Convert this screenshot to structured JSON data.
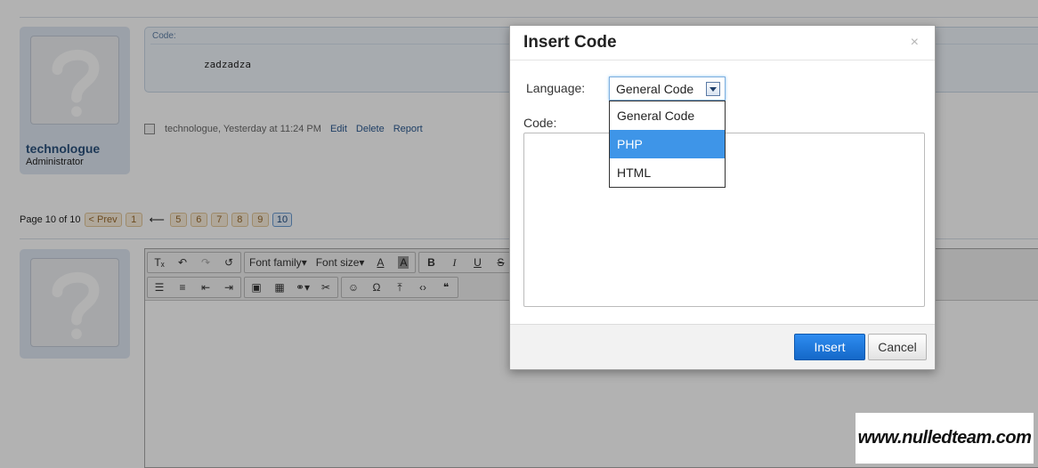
{
  "message": {
    "user_name": "technologue",
    "user_title": "Administrator",
    "code_label": "Code:",
    "code_text": "zadzadza",
    "meta_text": "technologue, Yesterday at 11:24 PM",
    "actions": [
      "Edit",
      "Delete",
      "Report"
    ]
  },
  "pagination": {
    "summary": "Page 10 of 10",
    "prev_label": "< Prev",
    "pages": [
      "1",
      "5",
      "6",
      "7",
      "8",
      "9",
      "10"
    ],
    "current": "10",
    "gap_arrow": "⟵"
  },
  "editor": {
    "font_family_label": "Font family",
    "font_size_label": "Font size"
  },
  "dialog": {
    "title": "Insert Code",
    "close_glyph": "×",
    "language_label": "Language:",
    "selected_language": "General Code",
    "language_options": [
      "General Code",
      "PHP",
      "HTML"
    ],
    "highlighted_option": "PHP",
    "code_label": "Code:",
    "code_value": "",
    "insert_label": "Insert",
    "cancel_label": "Cancel"
  },
  "watermark": "www.nulledteam.com",
  "colors": {
    "accent": "#3e95e8",
    "user_name": "#2b527d",
    "link": "#2b5a91",
    "overlay": "rgba(0,0,0,0.3)"
  }
}
